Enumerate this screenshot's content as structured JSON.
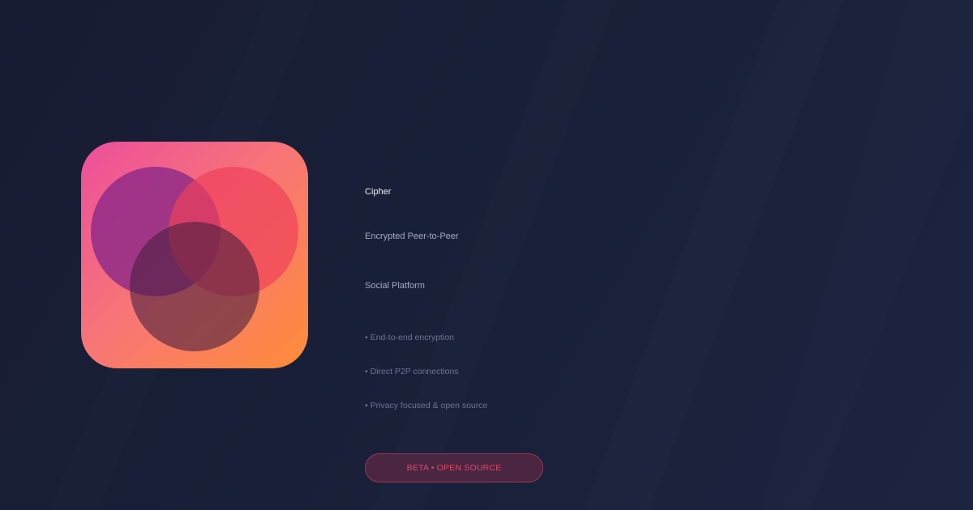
{
  "brand": {
    "name": "Cipher",
    "tagline_line1": "Encrypted Peer-to-Peer",
    "tagline_line2": "Social Platform"
  },
  "features": [
    "• End-to-end encryption",
    "• Direct P2P connections",
    "• Privacy focused & open source"
  ],
  "badge": {
    "label": "BETA • OPEN SOURCE"
  },
  "colors": {
    "background": "#171c33",
    "logo_gradient_start": "#ec4e9c",
    "logo_gradient_mid": "#f87676",
    "logo_gradient_end": "#fe8d38",
    "accent": "#e4455e"
  },
  "icons": {
    "logo": "three-overlapping-circles-icon"
  }
}
